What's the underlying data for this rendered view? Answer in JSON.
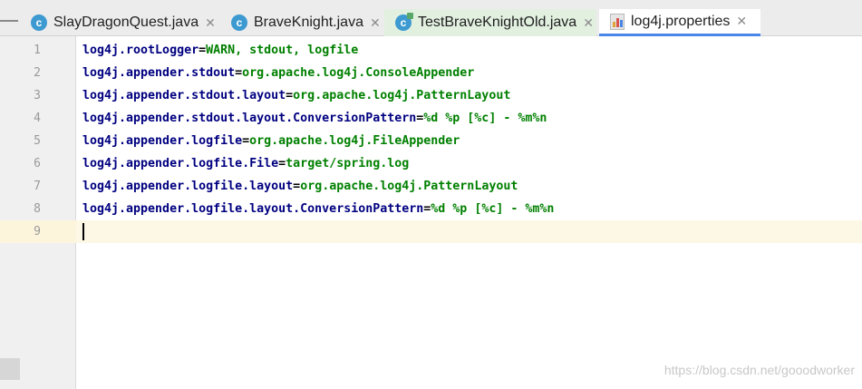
{
  "tabs": [
    {
      "label": "SlayDragonQuest.java",
      "icon": "java-class-icon",
      "selected": false
    },
    {
      "label": "BraveKnight.java",
      "icon": "java-class-icon",
      "selected": false
    },
    {
      "label": "TestBraveKnightOld.java",
      "icon": "java-test-class-icon",
      "selected": false
    },
    {
      "label": "log4j.properties",
      "icon": "properties-file-icon",
      "selected": true
    }
  ],
  "icon_letter": "c",
  "close_glyph": "✕",
  "line_numbers": [
    "1",
    "2",
    "3",
    "4",
    "5",
    "6",
    "7",
    "8",
    "9"
  ],
  "lines": [
    {
      "key": "log4j.rootLogger",
      "sep": "=",
      "value": "WARN, stdout, logfile"
    },
    {
      "key": "log4j.appender.stdout",
      "sep": "=",
      "value": "org.apache.log4j.ConsoleAppender"
    },
    {
      "key": "log4j.appender.stdout.layout",
      "sep": "=",
      "value": "org.apache.log4j.PatternLayout"
    },
    {
      "key": "log4j.appender.stdout.layout.ConversionPattern",
      "sep": "=",
      "value": "%d %p [%c] - %m%n"
    },
    {
      "key": "log4j.appender.logfile",
      "sep": "=",
      "value": "org.apache.log4j.FileAppender"
    },
    {
      "key": "log4j.appender.logfile.File",
      "sep": "=",
      "value": "target/spring.log"
    },
    {
      "key": "log4j.appender.logfile.layout",
      "sep": "=",
      "value": "org.apache.log4j.PatternLayout"
    },
    {
      "key": "log4j.appender.logfile.layout.ConversionPattern",
      "sep": "=",
      "value": "%d %p [%c] - %m%n"
    }
  ],
  "watermark": "https://blog.csdn.net/gooodworker",
  "colors": {
    "key": "#000080",
    "value": "#008000",
    "tab_underline": "#4a86e8",
    "caret_line": "#fdf8e5"
  }
}
